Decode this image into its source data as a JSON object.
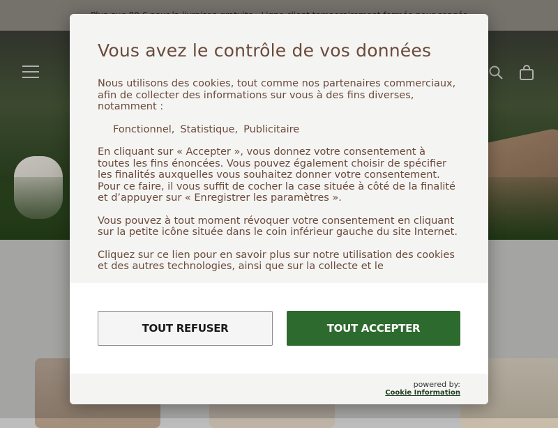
{
  "announcement": {
    "text": "Plus que 80 € pour la livraison gratuite · Ligne client temporairement fermée pour congés"
  },
  "header": {
    "menu_icon": "hamburger-icon",
    "search_icon": "search-icon",
    "cart_icon": "shopping-bag-icon"
  },
  "modal": {
    "title": "Vous avez le contrôle de vos données",
    "intro": "Nous utilisons des cookies, tout comme nos partenaires commerciaux, afin de collecter des informations sur vous à des fins diverses, notamment :",
    "purposes": [
      "Fonctionnel,",
      "Statistique,",
      "Publicitaire"
    ],
    "paragraph_accept": "En cliquant sur « Accepter », vous donnez votre consentement à toutes les fins énoncées. Vous pouvez également choisir de spécifier les finalités auxquelles vous souhaitez donner votre consentement. Pour ce faire, il vous suffit de cocher la case située à côté de la finalité et d’appuyer sur « Enregistrer les paramètres ».",
    "paragraph_revoke": "Vous pouvez à tout moment révoquer votre consentement en cliquant sur la petite icône située dans le coin inférieur gauche du site Internet.",
    "paragraph_more": "Cliquez sur ce lien pour en savoir plus sur notre utilisation des cookies et des autres technologies, ainsi que sur la collecte et le",
    "refuse_label": "TOUT REFUSER",
    "accept_label": "TOUT ACCEPTER",
    "powered_by": "powered by:",
    "provider": "Cookie Information"
  },
  "colors": {
    "accent_green": "#2d6a2e",
    "text_brown": "#6b4a3a"
  }
}
